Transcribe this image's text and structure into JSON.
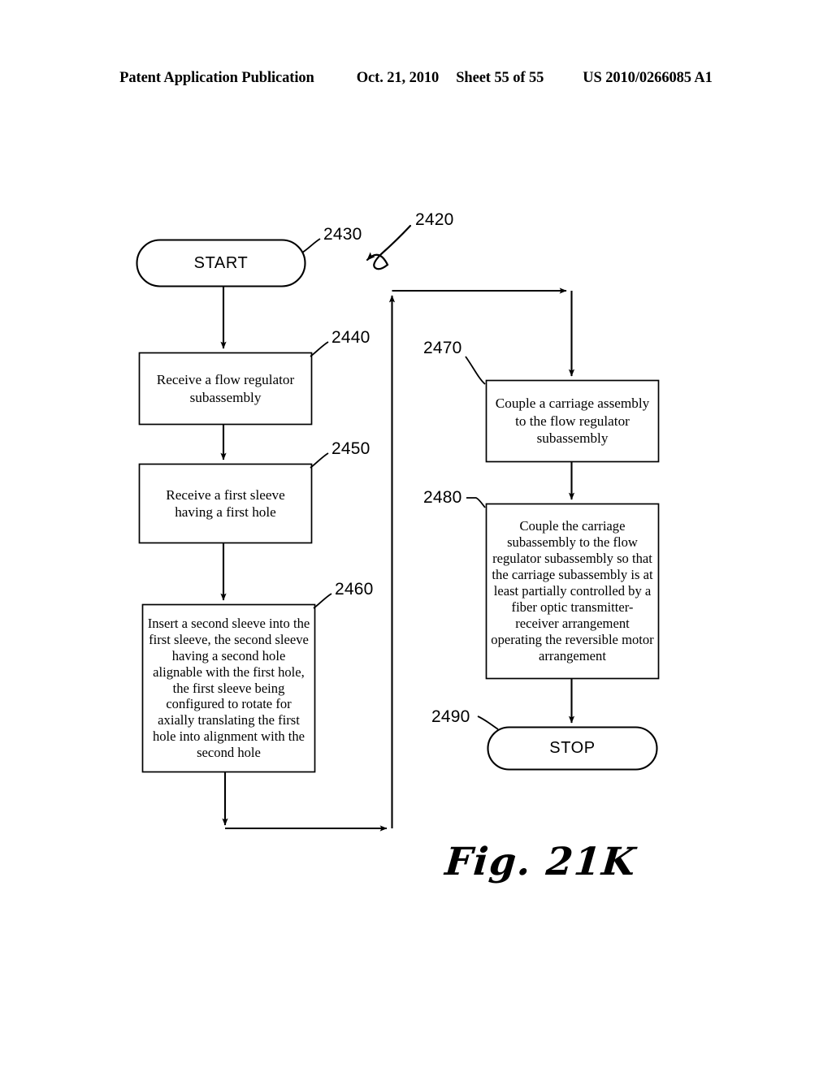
{
  "header": {
    "publication": "Patent Application Publication",
    "date": "Oct. 21, 2010",
    "sheet": "Sheet 55 of 55",
    "patent_number": "US 2010/0266085 A1"
  },
  "figure": {
    "caption": "Fig. 21K",
    "diagram_ref": "2420"
  },
  "flowchart": {
    "type": "flowchart",
    "orientation": "two-column, left column flows down then wraps to right column",
    "nodes": [
      {
        "ref": "2430",
        "shape": "terminal",
        "label": "START"
      },
      {
        "ref": "2440",
        "shape": "process",
        "label": "Receive a flow regulator subassembly"
      },
      {
        "ref": "2450",
        "shape": "process",
        "label": "Receive a first sleeve having a first hole"
      },
      {
        "ref": "2460",
        "shape": "process",
        "label": "Insert a second sleeve into the first sleeve, the second sleeve having a second hole alignable with the first hole, the first sleeve being configured to rotate for axially translating the first hole into alignment with the second hole"
      },
      {
        "ref": "2470",
        "shape": "process",
        "label": "Couple a carriage assembly to the flow regulator subassembly"
      },
      {
        "ref": "2480",
        "shape": "process",
        "label": "Couple the carriage subassembly to the flow regulator subassembly so that the carriage subassembly is at least partially controlled by a fiber optic transmitter-receiver arrangement operating the reversible motor arrangement"
      },
      {
        "ref": "2490",
        "shape": "terminal",
        "label": "STOP"
      }
    ],
    "edges": [
      {
        "from": "2430",
        "to": "2440"
      },
      {
        "from": "2440",
        "to": "2450"
      },
      {
        "from": "2450",
        "to": "2460"
      },
      {
        "from": "2460",
        "to": "2470",
        "routing": "down, right, up, right, down (page wrap)"
      },
      {
        "from": "2470",
        "to": "2480"
      },
      {
        "from": "2480",
        "to": "2490"
      }
    ]
  },
  "colors": {
    "ink": "#000000",
    "paper": "#ffffff"
  }
}
